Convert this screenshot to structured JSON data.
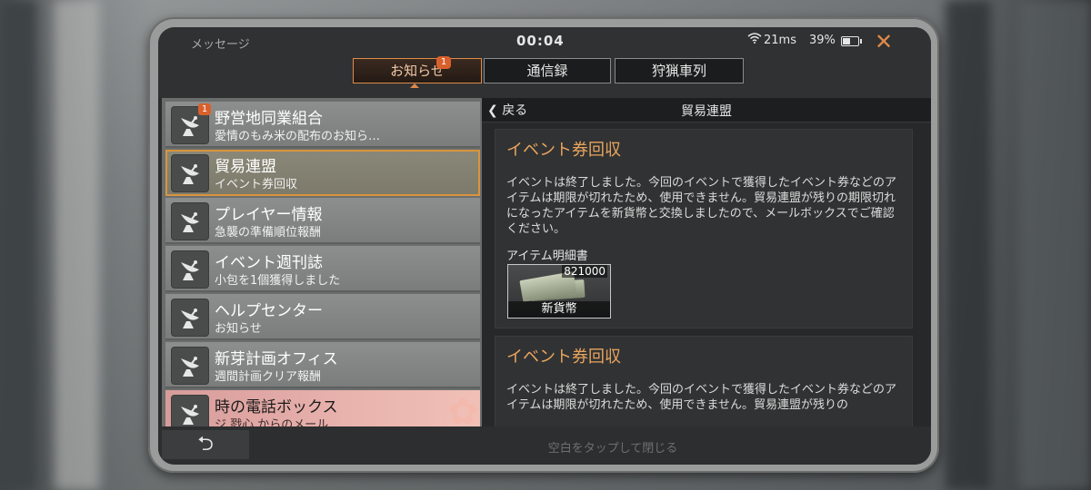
{
  "status": {
    "title": "メッセージ",
    "time": "00:04",
    "ping": "21ms",
    "battery": "39%",
    "close": "✕"
  },
  "tabs": [
    {
      "label": "お知らせ",
      "badge": "1",
      "active": true
    },
    {
      "label": "通信録"
    },
    {
      "label": "狩猟車列"
    }
  ],
  "list": [
    {
      "title": "野営地同業組合",
      "subtitle": "愛情のもみ米の配布のお知ら…",
      "badge": "1"
    },
    {
      "title": "貿易連盟",
      "subtitle": "イベント券回収",
      "selected": true
    },
    {
      "title": "プレイヤー情報",
      "subtitle": "急襲の準備順位報酬"
    },
    {
      "title": "イベント週刊誌",
      "subtitle": "小包を1個獲得しました"
    },
    {
      "title": "ヘルプセンター",
      "subtitle": "お知らせ"
    },
    {
      "title": "新芽計画オフィス",
      "subtitle": "週間計画クリア報酬"
    },
    {
      "title": "時の電話ボックス",
      "subtitle": "ジ 戮心 からのメール"
    }
  ],
  "detail": {
    "back": "戻る",
    "title": "貿易連盟",
    "messages": [
      {
        "title": "イベント券回収",
        "body": "イベントは終了しました。今回のイベントで獲得したイベント券などのアイテムは期限が切れたため、使用できません。貿易連盟が残りの期限切れになったアイテムを新貨幣と交換しましたので、メールボックスでご確認ください。",
        "attachment_label": "アイテム明細書",
        "attachment": {
          "name": "新貨幣",
          "count": "821000"
        }
      },
      {
        "title": "イベント券回収",
        "body": "イベントは終了しました。今回のイベントで獲得したイベント券などのアイテムは期限が切れたため、使用できません。貿易連盟が残りの"
      }
    ]
  },
  "bottom": {
    "hint": "空白をタップして閉じる"
  },
  "colors": {
    "accent": "#e08a4a",
    "badge": "#d9602c",
    "heading": "#e8a55e"
  }
}
